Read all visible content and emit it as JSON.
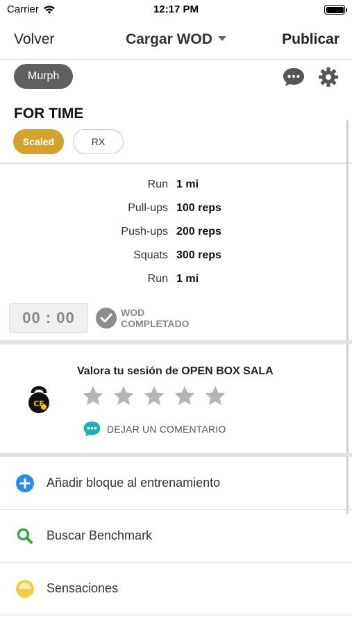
{
  "status": {
    "carrier": "Carrier",
    "time": "12:17 PM"
  },
  "nav": {
    "back": "Volver",
    "title": "Cargar WOD",
    "publish": "Publicar"
  },
  "wod": {
    "name": "Murph",
    "type": "FOR TIME",
    "modes": [
      "Scaled",
      "RX"
    ],
    "selected_mode": "Scaled",
    "exercises": [
      {
        "name": "Run",
        "qty": "1 mi"
      },
      {
        "name": "Pull-ups",
        "qty": "100 reps"
      },
      {
        "name": "Push-ups",
        "qty": "200 reps"
      },
      {
        "name": "Squats",
        "qty": "300 reps"
      },
      {
        "name": "Run",
        "qty": "1 mi"
      }
    ],
    "timer": "00 : 00",
    "completed_line1": "WOD",
    "completed_line2": "COMPLETADO"
  },
  "rating": {
    "title": "Valora tu sesión de OPEN BOX SALA",
    "stars_total": 5,
    "stars_selected": 0,
    "comment": "DEJAR UN COMENTARIO"
  },
  "menu": [
    {
      "label": "Añadir bloque al entrenamiento",
      "icon": "plus-circle-icon"
    },
    {
      "label": "Buscar Benchmark",
      "icon": "search-icon"
    },
    {
      "label": "Sensaciones",
      "icon": "mood-icon"
    }
  ],
  "colors": {
    "accent_gold": "#d4a22f",
    "pill_gray": "#5f5f5f",
    "plus_blue": "#2a8ef0",
    "search_green": "#3aa53a",
    "mood_yellow": "#f3cc4a",
    "comment_teal": "#19b3b1"
  }
}
